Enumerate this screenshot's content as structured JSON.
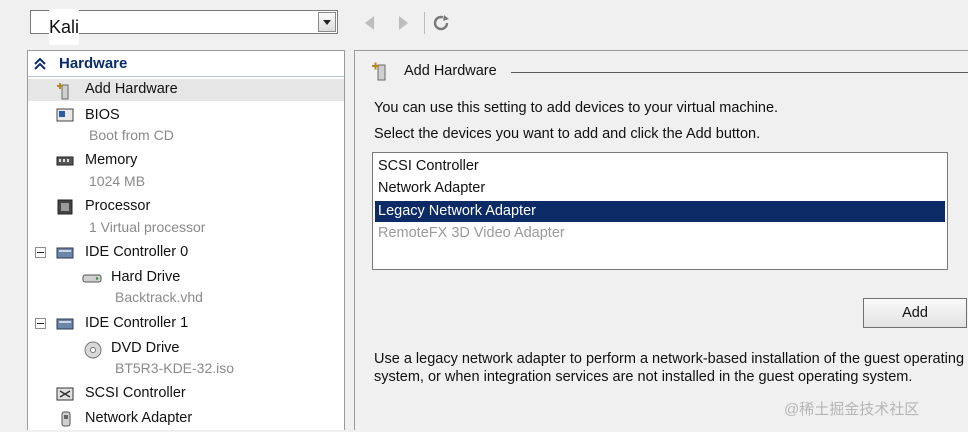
{
  "toolbar": {
    "vm_name": "Kali",
    "back_icon": "back-arrow-icon",
    "forward_icon": "forward-arrow-icon",
    "refresh_icon": "refresh-icon"
  },
  "sidebar": {
    "section_title": "Hardware",
    "items": [
      {
        "label": "Add Hardware",
        "icon": "add-hardware-icon"
      },
      {
        "label": "BIOS",
        "sub": "Boot from CD",
        "icon": "bios-icon"
      },
      {
        "label": "Memory",
        "sub": "1024 MB",
        "icon": "memory-icon"
      },
      {
        "label": "Processor",
        "sub": "1 Virtual processor",
        "icon": "processor-icon"
      },
      {
        "label": "IDE Controller 0",
        "icon": "ide-controller-icon"
      },
      {
        "label": "Hard Drive",
        "sub": "Backtrack.vhd",
        "icon": "hard-drive-icon"
      },
      {
        "label": "IDE Controller 1",
        "icon": "ide-controller-icon"
      },
      {
        "label": "DVD Drive",
        "sub": "BT5R3-KDE-32.iso",
        "icon": "dvd-drive-icon"
      },
      {
        "label": "SCSI Controller",
        "icon": "scsi-controller-icon"
      },
      {
        "label": "Network Adapter",
        "icon": "network-adapter-icon"
      }
    ]
  },
  "main": {
    "title": "Add Hardware",
    "line1": "You can use this setting to add devices to your virtual machine.",
    "line2": "Select the devices you want to add and click the Add button.",
    "devices": [
      {
        "label": "SCSI Controller"
      },
      {
        "label": "Network Adapter"
      },
      {
        "label": "Legacy Network Adapter"
      },
      {
        "label": "RemoteFX 3D Video Adapter"
      }
    ],
    "add_label": "Add",
    "description": "Use a legacy network adapter to perform a network-based installation of the guest operating system, or when integration services are not installed in the guest operating system."
  },
  "watermark": "@稀土掘金技术社区",
  "colors": {
    "selection": "#0b2a66",
    "header_text": "#0b2d6b"
  }
}
